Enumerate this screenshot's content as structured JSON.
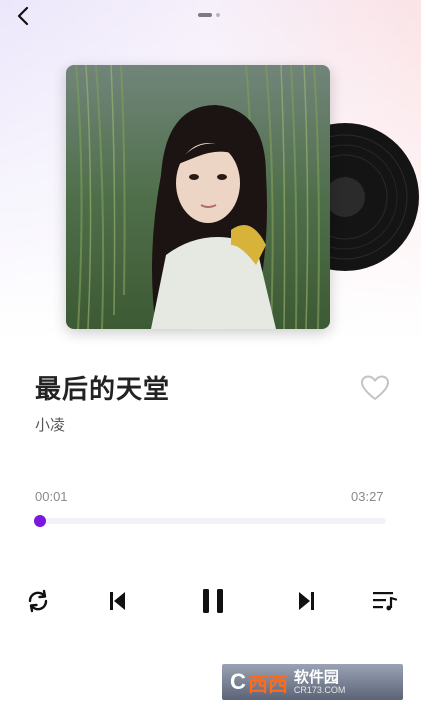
{
  "nav": {
    "back_icon": "chevron-left-icon",
    "page_count": 2,
    "active_page": 1
  },
  "song": {
    "title": "最后的天堂",
    "artist": "小凌",
    "liked": false,
    "like_icon": "heart-outline-icon"
  },
  "progress": {
    "current_time": "00:01",
    "total_time": "03:27",
    "fraction": 0.005,
    "accent_color": "#7a16e0"
  },
  "controls": {
    "repeat_icon": "repeat-icon",
    "prev_icon": "skip-previous-icon",
    "play_state": "playing",
    "pause_icon": "pause-icon",
    "next_icon": "skip-next-icon",
    "playlist_icon": "playlist-icon"
  },
  "watermark": {
    "mark": "C",
    "brand": "西西",
    "tagline": "软件园",
    "url": "CR173.COM"
  }
}
